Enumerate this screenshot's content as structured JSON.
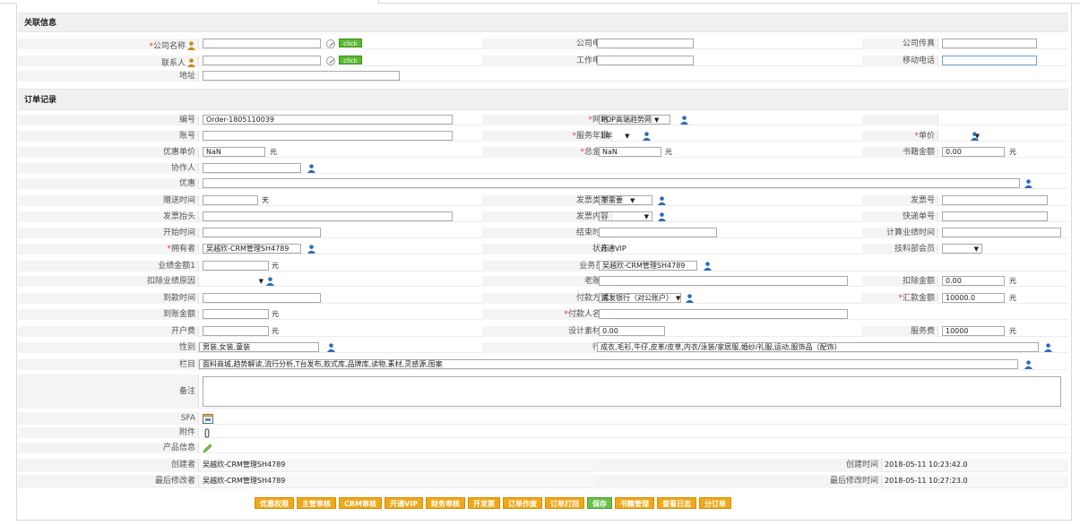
{
  "sections": {
    "related": "关联信息",
    "order": "订单记录"
  },
  "related": {
    "company_name_label": "公司名称",
    "company_phone_label": "公司电话",
    "company_fax_label": "公司传真",
    "contact_label": "联系人",
    "work_phone_label": "工作电话",
    "mobile_label": "移动电话",
    "address_label": "地址",
    "click_label": "click"
  },
  "order": {
    "no_label": "编号",
    "no_value": "Order-1805110039",
    "website_label": "网站",
    "website_value": "POP高端趋势网",
    "account_label": "账号",
    "years_label": "服务年限",
    "years_value": "1年",
    "price_label": "单价",
    "discount_price_label": "优惠单价",
    "discount_price_value": "NaN",
    "yuan": "元",
    "total_label": "总金额",
    "total_value": "NaN",
    "book_amount_label": "书籍金额",
    "book_amount_value": "0.00",
    "collaborator_label": "协作人",
    "discount_label": "优惠",
    "gift_days_label": "赠送时间",
    "days_unit": "天",
    "invoice_type_label": "发票类型",
    "invoice_type_value": "不需要",
    "invoice_no_label": "发票号",
    "invoice_title_label": "发票抬头",
    "invoice_content_label": "发票内容",
    "express_no_label": "快递单号",
    "start_label": "开始时间",
    "end_label": "结束时间",
    "perf_time_label": "计算业绩时间",
    "owner_label": "拥有者",
    "owner_value": "吴越欣-CRM管理SH4789",
    "status_label": "状态",
    "status_value": "开通VIP",
    "material_member_label": "技料部会员",
    "perf_amount1_label": "业绩金额1",
    "salesman1_label": "业务员1",
    "salesman1_value": "吴越欣-CRM管理SH4789",
    "deduct_reason_label": "扣除业绩原因",
    "old_account_label": "老账号",
    "deduct_amount_label": "扣除金额",
    "deduct_amount_value": "0.00",
    "arrival_time_label": "到款时间",
    "pay_method_label": "付款方式",
    "pay_method_value": "浦发银行（对公账户）",
    "remit_amount_label": "汇款金额",
    "remit_amount_value": "10000.0",
    "arrival_amount_label": "到账金额",
    "payer_label": "付款人名称",
    "open_fee_label": "开户费",
    "design_fee_label": "设计素材费",
    "design_fee_value": "0.00",
    "service_fee_label": "服务费",
    "service_fee_value": "10000",
    "gender_label": "性别",
    "gender_value": "男装,女装,童装",
    "industry_label": "行业",
    "industry_value": "成衣,毛衫,牛仔,皮革/皮草,内衣/泳装/家居服,婚纱/礼服,运动,服饰品（配饰）",
    "column_label": "栏目",
    "column_value": "面料商城,趋势解读,流行分析,T台发布,款式库,品牌库,读物,素材,灵感源,图案",
    "remark_label": "备注",
    "sfa_label": "SFA",
    "attach_label": "附件",
    "product_label": "产品信息",
    "creator_label": "创建者",
    "creator_value": "吴越欣-CRM管理SH4789",
    "created_time_label": "创建时间",
    "created_time_value": "2018-05-11 10:23:42.0",
    "modifier_label": "最后修改者",
    "modifier_value": "吴越欣-CRM管理SH4789",
    "modified_time_label": "最后修改时间",
    "modified_time_value": "2018-05-11 10:27:23.0"
  },
  "buttons": [
    "优惠权限",
    "主管审核",
    "CRM审核",
    "开通VIP",
    "财务审核",
    "开发票",
    "订单作废",
    "订单打回",
    "保存",
    "书籍管理",
    "查看日志",
    "分订单"
  ],
  "icons": [
    "person-icon",
    "edit-icon",
    "calendar-icon",
    "clip-icon",
    "pencil-icon"
  ]
}
